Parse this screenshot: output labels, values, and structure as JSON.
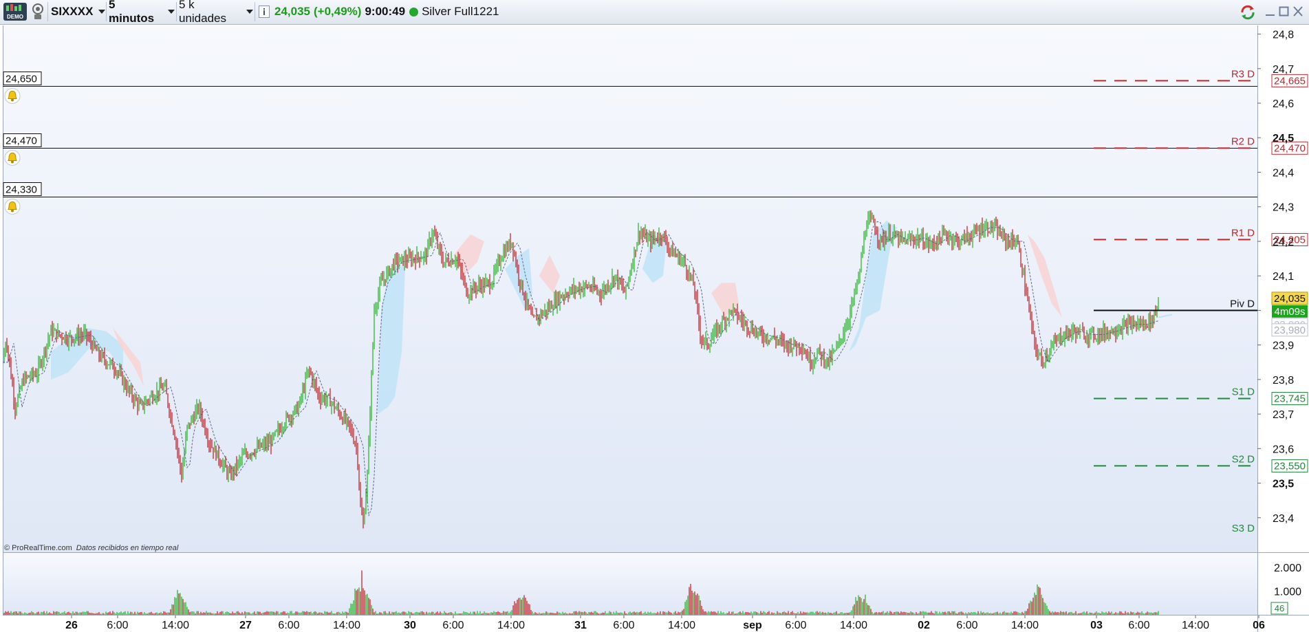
{
  "toolbar": {
    "demo_badge": "DEMO",
    "symbol": "SIXXXX",
    "timeframe": "5 minutos",
    "units": "5 k unidades",
    "last_price": "24,035",
    "change": "(+0,49%)",
    "time": "9:00:49",
    "instrument": "Silver Full1221"
  },
  "colors": {
    "up": "#1db31d",
    "down": "#c4161c",
    "resistance": "#c0282d",
    "support": "#1f8a3a",
    "cloud_bull": "#bfe3f7",
    "cloud_bear": "#f8d4d4",
    "plot_bg_top": "#f7f9fd",
    "plot_bg_bottom": "#dfe7f6",
    "price_badge": "#f5d94a"
  },
  "alerts": [
    {
      "value": 24.65,
      "label": "24,650"
    },
    {
      "value": 24.47,
      "label": "24,470"
    },
    {
      "value": 24.33,
      "label": "24,330"
    }
  ],
  "pivots": [
    {
      "name": "R3 D",
      "value": 24.665,
      "label": "24,665",
      "kind": "resistance"
    },
    {
      "name": "R2 D",
      "value": 24.47,
      "label": "24,470",
      "kind": "resistance"
    },
    {
      "name": "R1 D",
      "value": 24.205,
      "label": "24,205",
      "kind": "resistance"
    },
    {
      "name": "Piv D",
      "value": 24.0,
      "label": "",
      "kind": "pivot"
    },
    {
      "name": "S1 D",
      "value": 23.745,
      "label": "23,745",
      "kind": "support"
    },
    {
      "name": "S2 D",
      "value": 23.55,
      "label": "23,550",
      "kind": "support"
    },
    {
      "name": "S3 D",
      "value": 23.35,
      "label": "",
      "kind": "support"
    }
  ],
  "price_badges": {
    "last": "24,035",
    "countdown": "4m09s",
    "hidden": "23,980",
    "cloud": "23,980"
  },
  "attribution": "© ProRealTime.com",
  "attribution_note": "Datos recibidos en tiempo real",
  "volume_badge": "46",
  "chart_data": {
    "type": "line",
    "title": "",
    "y_ticks": [
      "24,8",
      "24,7",
      "24,6",
      "24,5",
      "24,4",
      "24,3",
      "24,2",
      "24,1",
      "24",
      "23,9",
      "23,8",
      "23,7",
      "23,6",
      "23,5",
      "23,4"
    ],
    "y_ticks_bold": [
      "24,5",
      "23,5"
    ],
    "ylim": [
      23.3,
      24.825
    ],
    "x_ticks": [
      "26",
      "6:00",
      "14:00",
      "27",
      "6:00",
      "14:00",
      "30",
      "6:00",
      "14:00",
      "31",
      "6:00",
      "14:00",
      "sep",
      "6:00",
      "14:00",
      "02",
      "6:00",
      "14:00",
      "03",
      "6:00",
      "14:00",
      "06"
    ],
    "x_ticks_bold": [
      "26",
      "27",
      "30",
      "31",
      "sep",
      "02",
      "03",
      "06"
    ],
    "x_tick_index": [
      100,
      167,
      251,
      353,
      416,
      500,
      592,
      655,
      739,
      840,
      903,
      987,
      1090,
      1153,
      1237,
      1339,
      1402,
      1486,
      1590,
      1652,
      1734,
      1826
    ],
    "price_path": [
      [
        0,
        23.85
      ],
      [
        5,
        23.92
      ],
      [
        18,
        23.72
      ],
      [
        30,
        23.8
      ],
      [
        50,
        23.82
      ],
      [
        70,
        23.94
      ],
      [
        95,
        23.92
      ],
      [
        120,
        23.93
      ],
      [
        140,
        23.87
      ],
      [
        165,
        23.83
      ],
      [
        185,
        23.76
      ],
      [
        200,
        23.72
      ],
      [
        215,
        23.75
      ],
      [
        235,
        23.78
      ],
      [
        252,
        23.62
      ],
      [
        260,
        23.52
      ],
      [
        268,
        23.66
      ],
      [
        285,
        23.72
      ],
      [
        300,
        23.62
      ],
      [
        318,
        23.56
      ],
      [
        330,
        23.52
      ],
      [
        350,
        23.58
      ],
      [
        370,
        23.6
      ],
      [
        390,
        23.62
      ],
      [
        410,
        23.68
      ],
      [
        430,
        23.72
      ],
      [
        445,
        23.83
      ],
      [
        460,
        23.75
      ],
      [
        475,
        23.74
      ],
      [
        490,
        23.7
      ],
      [
        505,
        23.66
      ],
      [
        515,
        23.6
      ],
      [
        520,
        23.43
      ],
      [
        524,
        23.38
      ],
      [
        530,
        23.52
      ],
      [
        540,
        24.0
      ],
      [
        550,
        24.08
      ],
      [
        570,
        24.14
      ],
      [
        595,
        24.15
      ],
      [
        615,
        24.16
      ],
      [
        625,
        24.23
      ],
      [
        640,
        24.14
      ],
      [
        660,
        24.15
      ],
      [
        675,
        24.05
      ],
      [
        690,
        24.07
      ],
      [
        710,
        24.08
      ],
      [
        725,
        24.16
      ],
      [
        740,
        24.2
      ],
      [
        750,
        24.1
      ],
      [
        760,
        24.03
      ],
      [
        770,
        23.97
      ],
      [
        790,
        24.0
      ],
      [
        810,
        24.04
      ],
      [
        830,
        24.06
      ],
      [
        850,
        24.07
      ],
      [
        870,
        24.05
      ],
      [
        890,
        24.1
      ],
      [
        905,
        24.05
      ],
      [
        925,
        24.23
      ],
      [
        940,
        24.2
      ],
      [
        958,
        24.22
      ],
      [
        972,
        24.17
      ],
      [
        990,
        24.14
      ],
      [
        1005,
        24.07
      ],
      [
        1015,
        23.92
      ],
      [
        1025,
        23.9
      ],
      [
        1040,
        23.95
      ],
      [
        1060,
        24.0
      ],
      [
        1080,
        23.96
      ],
      [
        1100,
        23.93
      ],
      [
        1120,
        23.92
      ],
      [
        1140,
        23.9
      ],
      [
        1160,
        23.9
      ],
      [
        1175,
        23.85
      ],
      [
        1185,
        23.88
      ],
      [
        1200,
        23.85
      ],
      [
        1215,
        23.9
      ],
      [
        1230,
        23.98
      ],
      [
        1245,
        24.1
      ],
      [
        1255,
        24.25
      ],
      [
        1265,
        24.26
      ],
      [
        1275,
        24.2
      ],
      [
        1290,
        24.22
      ],
      [
        1310,
        24.2
      ],
      [
        1330,
        24.21
      ],
      [
        1350,
        24.19
      ],
      [
        1370,
        24.22
      ],
      [
        1390,
        24.2
      ],
      [
        1410,
        24.22
      ],
      [
        1425,
        24.24
      ],
      [
        1440,
        24.24
      ],
      [
        1460,
        24.2
      ],
      [
        1475,
        24.2
      ],
      [
        1488,
        24.05
      ],
      [
        1500,
        23.9
      ],
      [
        1510,
        23.85
      ],
      [
        1520,
        23.88
      ],
      [
        1535,
        23.92
      ],
      [
        1555,
        23.94
      ],
      [
        1575,
        23.93
      ],
      [
        1590,
        23.93
      ],
      [
        1610,
        23.94
      ],
      [
        1625,
        23.95
      ],
      [
        1640,
        23.96
      ],
      [
        1655,
        23.96
      ],
      [
        1670,
        23.97
      ],
      [
        1680,
        24.02
      ]
    ],
    "cloud_bull": [
      [
        [
          70,
          23.88
        ],
        [
          70,
          23.8
        ],
        [
          95,
          23.82
        ],
        [
          130,
          23.9
        ],
        [
          155,
          23.88
        ],
        [
          175,
          23.82
        ],
        [
          175,
          23.9
        ],
        [
          150,
          23.94
        ],
        [
          120,
          23.95
        ],
        [
          95,
          23.92
        ]
      ],
      [
        [
          545,
          23.7
        ],
        [
          560,
          23.72
        ],
        [
          570,
          23.75
        ],
        [
          580,
          23.88
        ],
        [
          585,
          24.12
        ],
        [
          575,
          24.14
        ],
        [
          560,
          24.1
        ],
        [
          550,
          24.0
        ]
      ],
      [
        [
          730,
          24.12
        ],
        [
          745,
          24.06
        ],
        [
          760,
          24.0
        ],
        [
          770,
          24.05
        ],
        [
          765,
          24.18
        ],
        [
          750,
          24.16
        ]
      ],
      [
        [
          930,
          24.12
        ],
        [
          945,
          24.08
        ],
        [
          960,
          24.1
        ],
        [
          965,
          24.2
        ],
        [
          945,
          24.22
        ]
      ],
      [
        [
          1230,
          23.88
        ],
        [
          1240,
          23.9
        ],
        [
          1255,
          23.98
        ],
        [
          1275,
          24.0
        ],
        [
          1290,
          24.18
        ],
        [
          1300,
          24.24
        ],
        [
          1285,
          24.26
        ],
        [
          1265,
          24.22
        ],
        [
          1255,
          24.1
        ],
        [
          1245,
          23.95
        ]
      ]
    ],
    "cloud_bear": [
      [
        [
          160,
          23.95
        ],
        [
          180,
          23.9
        ],
        [
          200,
          23.85
        ],
        [
          205,
          23.78
        ],
        [
          190,
          23.84
        ],
        [
          170,
          23.9
        ]
      ],
      [
        [
          655,
          24.16
        ],
        [
          670,
          24.1
        ],
        [
          690,
          24.14
        ],
        [
          700,
          24.2
        ],
        [
          680,
          24.22
        ]
      ],
      [
        [
          780,
          24.1
        ],
        [
          800,
          24.05
        ],
        [
          810,
          24.1
        ],
        [
          795,
          24.16
        ]
      ],
      [
        [
          1030,
          24.05
        ],
        [
          1050,
          23.98
        ],
        [
          1070,
          24.02
        ],
        [
          1065,
          24.08
        ],
        [
          1045,
          24.08
        ]
      ],
      [
        [
          1490,
          24.22
        ],
        [
          1510,
          24.1
        ],
        [
          1525,
          24.02
        ],
        [
          1540,
          23.98
        ],
        [
          1530,
          24.05
        ],
        [
          1515,
          24.15
        ],
        [
          1500,
          24.2
        ]
      ]
    ],
    "volume_ylim": [
      0,
      2600
    ],
    "volume_ticks": [
      "2.000",
      "1.000"
    ],
    "volume_spikes": [
      [
        255,
        1400
      ],
      [
        260,
        1050
      ],
      [
        515,
        1500
      ],
      [
        522,
        1900
      ],
      [
        528,
        1200
      ],
      [
        750,
        1000
      ],
      [
        758,
        1150
      ],
      [
        1000,
        1400
      ],
      [
        1008,
        1200
      ],
      [
        1245,
        1200
      ],
      [
        1252,
        1000
      ],
      [
        1500,
        1150
      ],
      [
        1505,
        1500
      ],
      [
        1510,
        1100
      ]
    ]
  }
}
